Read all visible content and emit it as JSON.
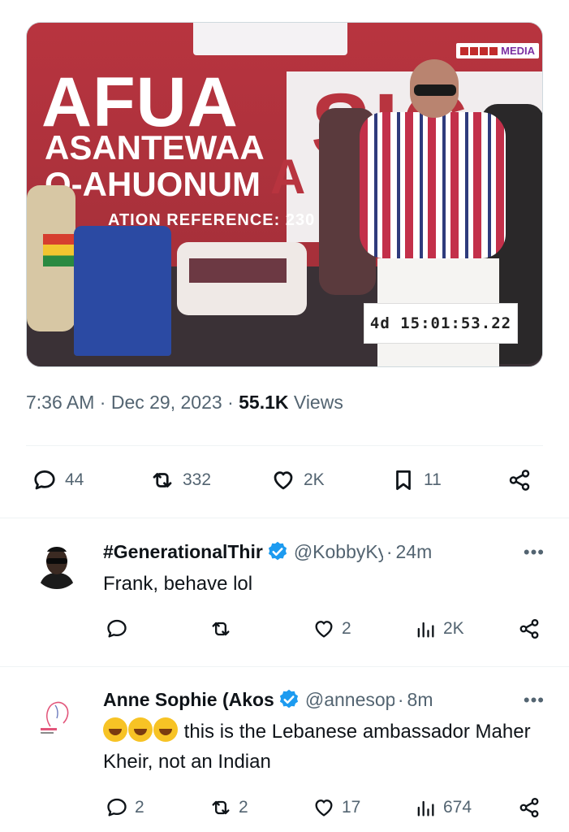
{
  "media": {
    "title_line1": "AFUA",
    "title_line2": "ASANTEWAA",
    "title_line3": "O-AHUONUM",
    "reference_text": "ATION REFERENCE: 230",
    "wall_letters": "SIG",
    "wall_letters2": "A",
    "watermark": "MEDIA",
    "timer": "4d 15:01:53.22"
  },
  "tweet_meta": {
    "time": "7:36 AM",
    "date": "Dec 29, 2023",
    "views_count": "55.1K",
    "views_label": "Views"
  },
  "stats": {
    "replies": "44",
    "reposts": "332",
    "likes": "2K",
    "bookmarks": "11"
  },
  "replies": [
    {
      "name": "#GenerationalThir",
      "handle": "@KobbyKy",
      "time": "24m",
      "text": "Frank, behave lol",
      "replies": "",
      "reposts": "",
      "likes": "2",
      "views": "2K"
    },
    {
      "name": "Anne Sophie (Akos",
      "handle": "@annesoph",
      "time": "8m",
      "text_after_emoji": "this is the Lebanese ambassador Maher Kheir, not an Indian",
      "replies": "2",
      "reposts": "2",
      "likes": "17",
      "views": "674"
    }
  ],
  "colors": {
    "text_primary": "#0f1419",
    "text_secondary": "#536471",
    "verified_blue": "#1d9bf0",
    "divider": "#eff3f4"
  }
}
